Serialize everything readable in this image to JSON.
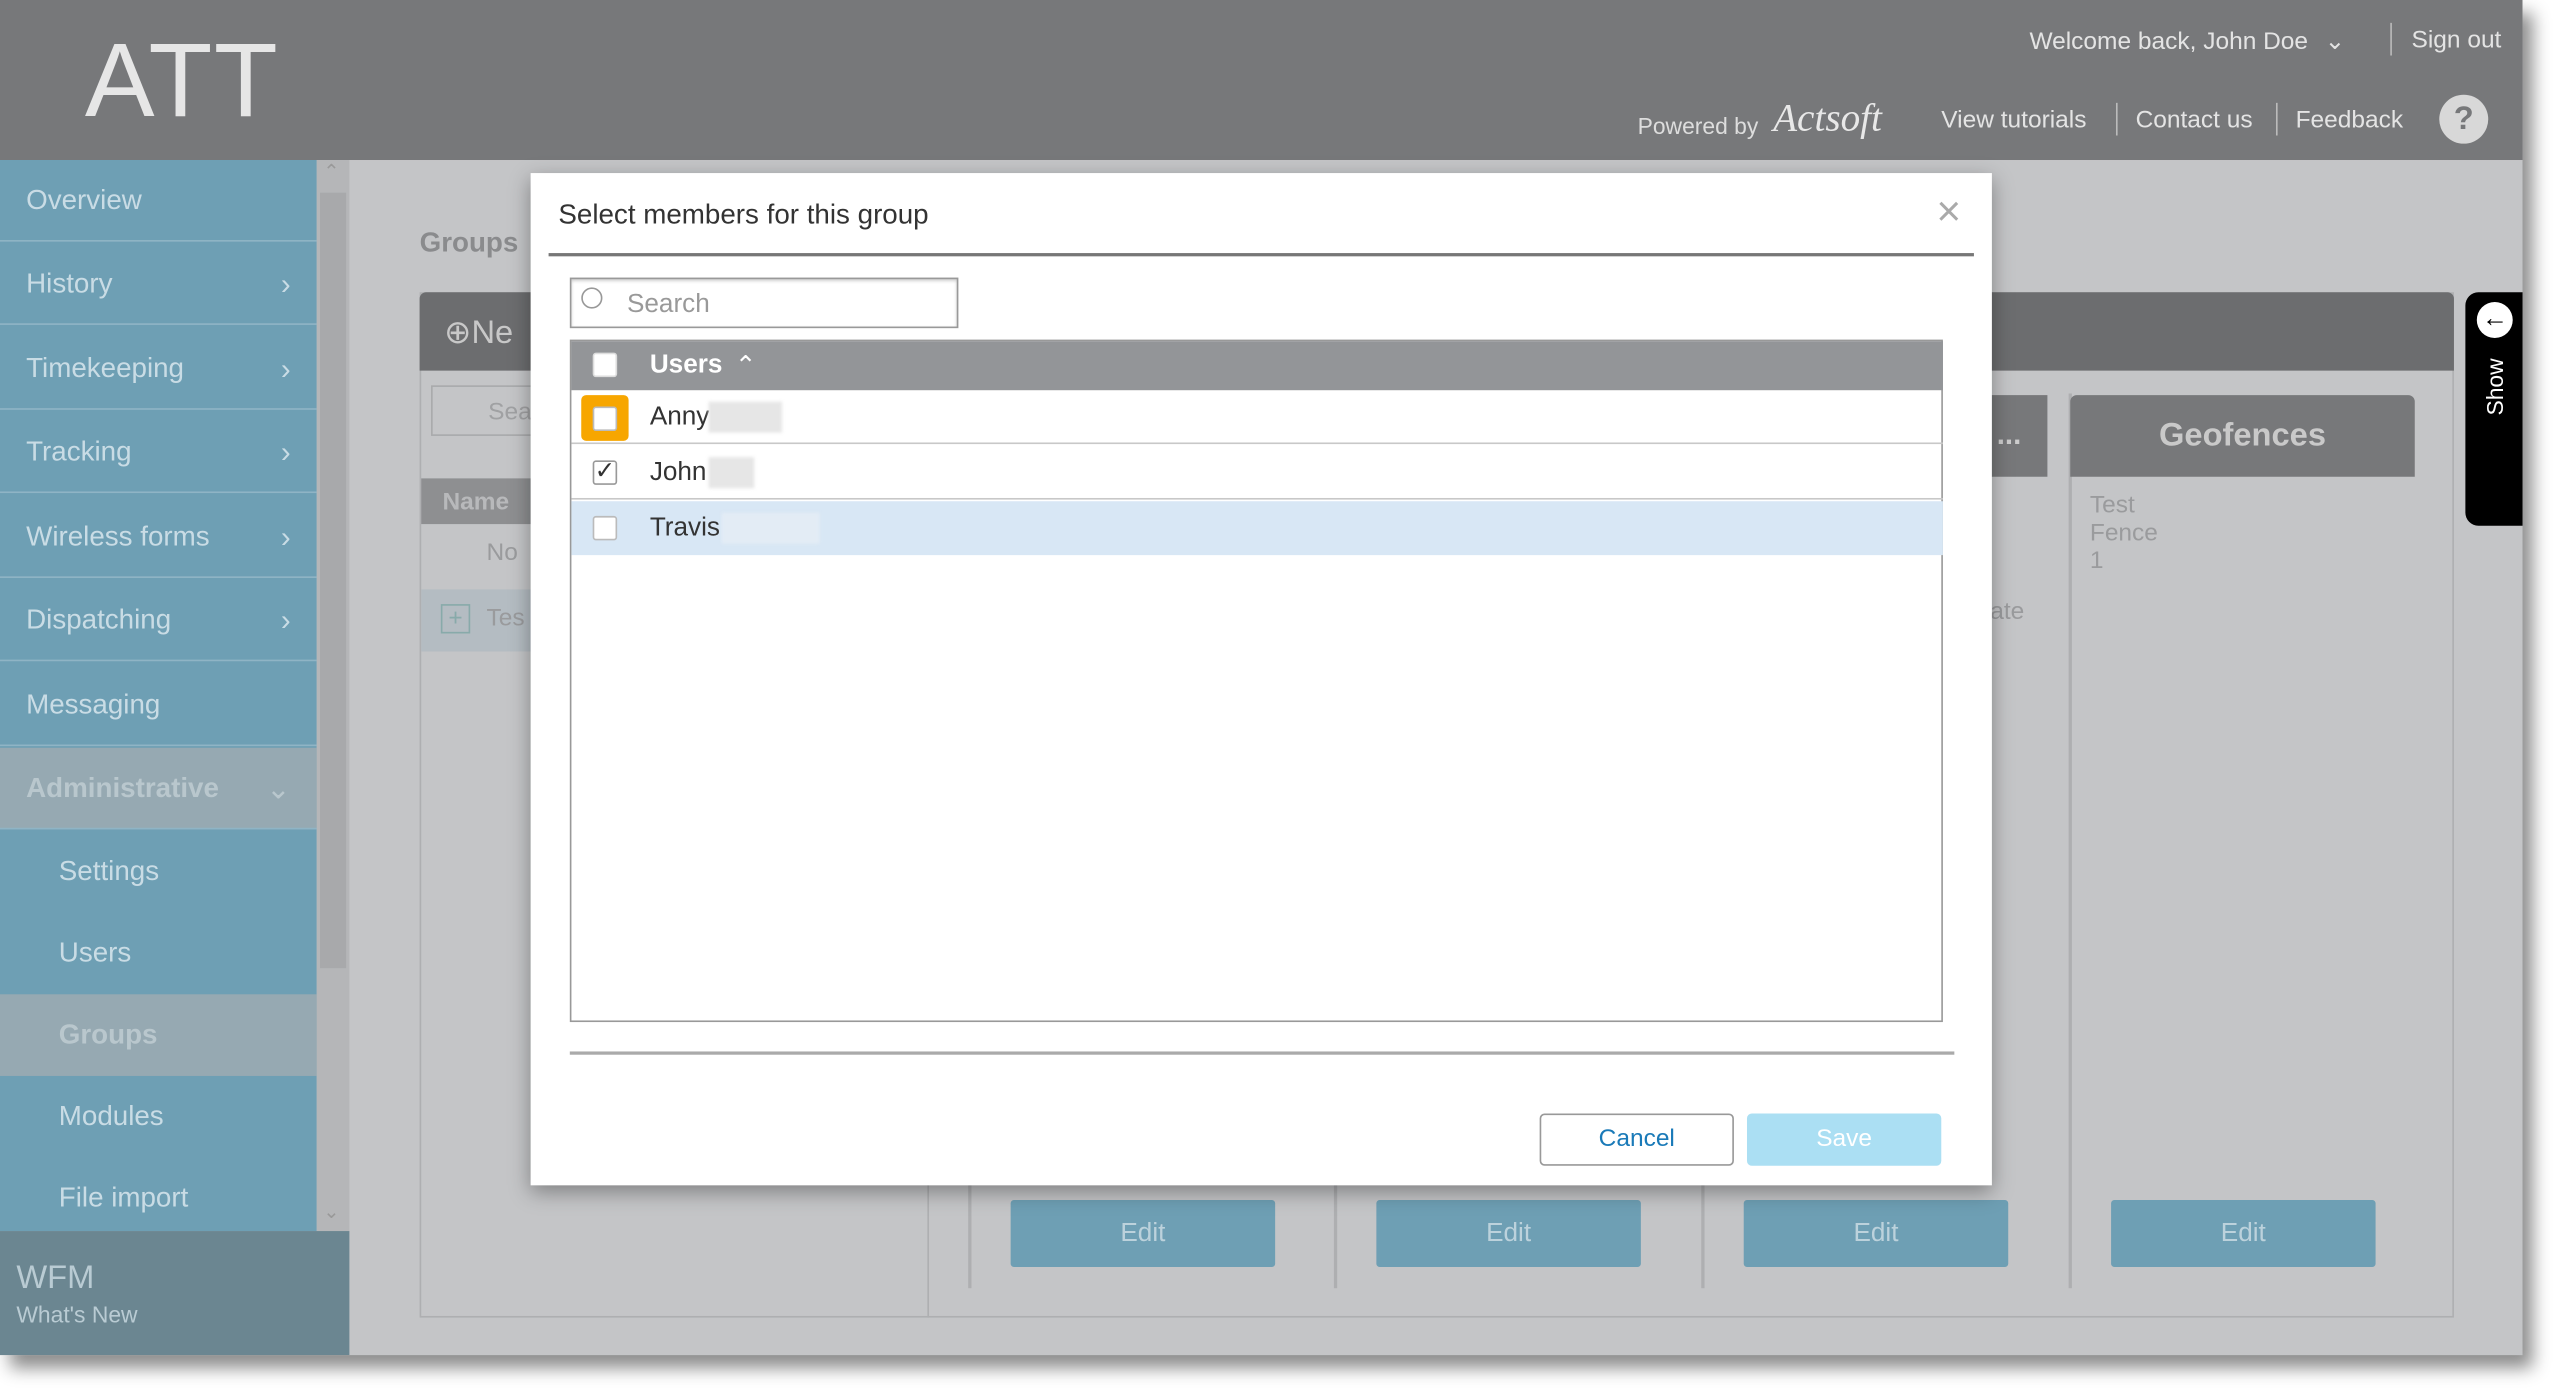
{
  "header": {
    "logo": "ATT",
    "welcome": "Welcome back, John Doe",
    "sign_out": "Sign out",
    "powered_by": "Powered by",
    "brand_logo": "Actsoft",
    "links": [
      "View tutorials",
      "Contact us",
      "Feedback"
    ],
    "help": "?"
  },
  "sidebar": {
    "items": [
      {
        "label": "Overview"
      },
      {
        "label": "History"
      },
      {
        "label": "Timekeeping"
      },
      {
        "label": "Tracking"
      },
      {
        "label": "Wireless forms"
      },
      {
        "label": "Dispatching"
      },
      {
        "label": "Messaging"
      },
      {
        "label": "Administrative"
      }
    ],
    "subitems": [
      {
        "label": "Settings"
      },
      {
        "label": "Users"
      },
      {
        "label": "Groups",
        "active": true
      },
      {
        "label": "Modules"
      },
      {
        "label": "File import"
      }
    ],
    "footer": {
      "title": "WFM",
      "subtitle": "What's New"
    }
  },
  "background": {
    "page_title": "Groups",
    "new_button": "Ne",
    "search_placeholder": "Sea",
    "name_header": "Name",
    "no_text": "No",
    "row_text": "Tes",
    "card3_title": "...",
    "card3_text": "ate",
    "geofences_title": "Geofences",
    "geofence_item": "Test Fence 1",
    "edit_label": "Edit",
    "show_tab": "Show"
  },
  "modal": {
    "title": "Select members for this group",
    "search_placeholder": "Search",
    "column_header": "Users",
    "sort": "ascending",
    "rows": [
      {
        "name": "Anny",
        "checked": false,
        "focused": true
      },
      {
        "name": "John",
        "checked": true
      },
      {
        "name": "Travis",
        "checked": false,
        "highlighted": true
      }
    ],
    "cancel": "Cancel",
    "save": "Save"
  },
  "colors": {
    "accent": "#1a7ab8",
    "focus": "#f7a600",
    "highlight": "#d8e7f5",
    "save_disabled": "#abdff3"
  }
}
